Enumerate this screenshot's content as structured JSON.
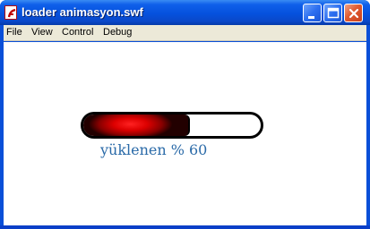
{
  "window": {
    "title": "loader animasyon.swf",
    "icon": "flash-player-icon",
    "controls": [
      "minimize-icon",
      "maximize-icon",
      "close-icon"
    ]
  },
  "menu": {
    "items": [
      "File",
      "View",
      "Control",
      "Debug"
    ]
  },
  "loader": {
    "label": "yüklenen %",
    "percent": 60,
    "percent_text": "60",
    "fill_color": "#dd0000",
    "label_color": "#2a6aa8"
  }
}
